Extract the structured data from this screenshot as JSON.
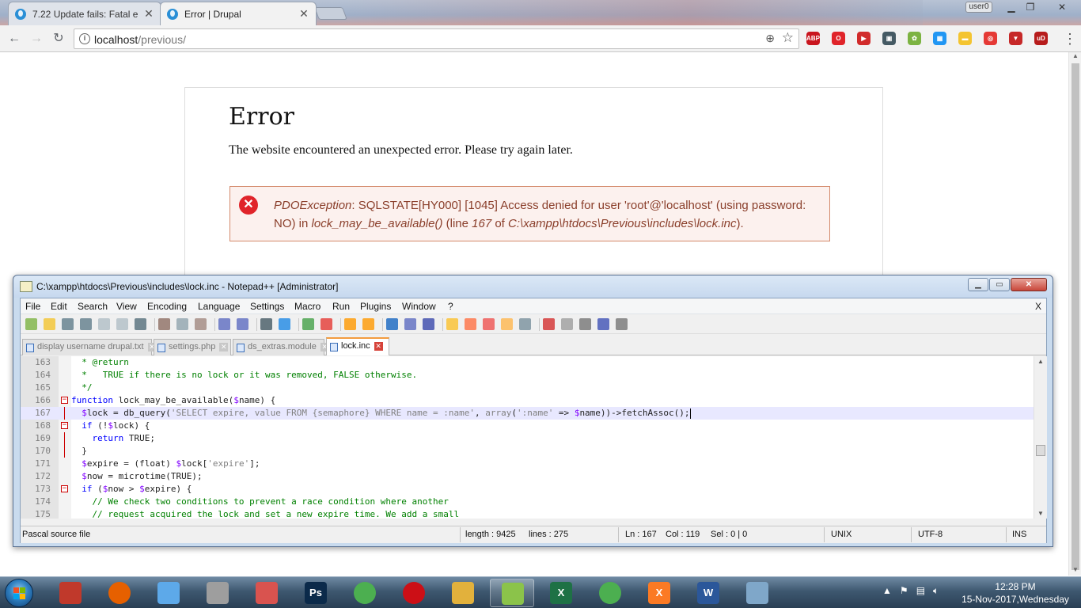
{
  "browser": {
    "tabs": [
      {
        "title": "7.22 Update fails: Fatal e",
        "active": false
      },
      {
        "title": "Error | Drupal",
        "active": true
      }
    ],
    "user_badge": "user0",
    "url_host": "localhost",
    "url_path": "/previous/",
    "extensions": [
      {
        "icon": "adblock-plus-icon",
        "label": "ABP",
        "color": "#c9151e"
      },
      {
        "icon": "opera-icon",
        "label": "O",
        "color": "#e0242a"
      },
      {
        "icon": "media-icon",
        "label": "▶",
        "color": "#d12b2b"
      },
      {
        "icon": "bus-icon",
        "label": "▣",
        "color": "#455a64"
      },
      {
        "icon": "basket-icon",
        "label": "✿",
        "color": "#7cb342"
      },
      {
        "icon": "calendar-icon",
        "label": "▦",
        "color": "#2196f3"
      },
      {
        "icon": "folder-icon",
        "label": "▬",
        "color": "#f4c430"
      },
      {
        "icon": "target-icon",
        "label": "◎",
        "color": "#e53935"
      },
      {
        "icon": "shield-icon",
        "label": "▼",
        "color": "#c62828"
      },
      {
        "icon": "ublock-icon",
        "label": "uD",
        "color": "#b71c1c"
      }
    ]
  },
  "page": {
    "title": "Error",
    "message": "The website encountered an unexpected error. Please try again later.",
    "exception": {
      "type": "PDOException",
      "text1": ": SQLSTATE[HY000] [1045] Access denied for user 'root'@'localhost' (using password: NO) in ",
      "function": "lock_may_be_available()",
      "text2": " (line ",
      "line": "167",
      "text3": " of ",
      "file": "C:\\xampp\\htdocs\\Previous\\includes\\lock.inc",
      "text4": ")."
    }
  },
  "npp": {
    "title": "C:\\xampp\\htdocs\\Previous\\includes\\lock.inc - Notepad++ [Administrator]",
    "menu": [
      "File",
      "Edit",
      "Search",
      "View",
      "Encoding",
      "Language",
      "Settings",
      "Macro",
      "Run",
      "Plugins",
      "Window",
      "?"
    ],
    "menu_close": "X",
    "tabs": [
      {
        "label": "display username drupal.txt",
        "active": false
      },
      {
        "label": "settings.php",
        "active": false
      },
      {
        "label": "ds_extras.module",
        "active": false
      },
      {
        "label": "lock.inc",
        "active": true
      }
    ],
    "lines": [
      {
        "n": "163",
        "code": "  * @return"
      },
      {
        "n": "164",
        "code": "  *   TRUE if there is no lock or it was removed, FALSE otherwise."
      },
      {
        "n": "165",
        "code": "  */"
      },
      {
        "n": "166",
        "code": "function lock_may_be_available($name) {"
      },
      {
        "n": "167",
        "code": "  $lock = db_query('SELECT expire, value FROM {semaphore} WHERE name = :name', array(':name' => $name))->fetchAssoc();"
      },
      {
        "n": "168",
        "code": "  if (!$lock) {"
      },
      {
        "n": "169",
        "code": "    return TRUE;"
      },
      {
        "n": "170",
        "code": "  }"
      },
      {
        "n": "171",
        "code": "  $expire = (float) $lock['expire'];"
      },
      {
        "n": "172",
        "code": "  $now = microtime(TRUE);"
      },
      {
        "n": "173",
        "code": "  if ($now > $expire) {"
      },
      {
        "n": "174",
        "code": "    // We check two conditions to prevent a race condition where another"
      },
      {
        "n": "175",
        "code": "    // request acquired the lock and set a new expire time. We add a small"
      }
    ],
    "status": {
      "type": "Pascal source file",
      "length": "length : 9425",
      "lines": "lines : 275",
      "ln": "Ln : 167",
      "col": "Col : 119",
      "sel": "Sel : 0 | 0",
      "eol": "UNIX",
      "encoding": "UTF-8",
      "mode": "INS"
    }
  },
  "taskbar": {
    "apps": [
      {
        "name": "filezilla-app",
        "label": "",
        "color": "#c0392b"
      },
      {
        "name": "firefox-app",
        "label": "",
        "color": "#e66000"
      },
      {
        "name": "paint-app",
        "label": "",
        "color": "#5da9e9"
      },
      {
        "name": "utility-app",
        "label": "",
        "color": "#9e9e9e"
      },
      {
        "name": "snipping-app",
        "label": "",
        "color": "#d9534f"
      },
      {
        "name": "photoshop-app",
        "label": "Ps",
        "color": "#0b2a4a"
      },
      {
        "name": "chrome-app",
        "label": "",
        "color": "#4caf50"
      },
      {
        "name": "opera-app",
        "label": "",
        "color": "#cc0f16"
      },
      {
        "name": "explorer-app",
        "label": "",
        "color": "#e2b13c"
      },
      {
        "name": "notepadpp-app",
        "label": "",
        "color": "#8bc34a"
      },
      {
        "name": "excel-app",
        "label": "X",
        "color": "#1e7145"
      },
      {
        "name": "chrome-app-2",
        "label": "",
        "color": "#4caf50"
      },
      {
        "name": "xampp-app",
        "label": "X",
        "color": "#fb7a24"
      },
      {
        "name": "word-app",
        "label": "W",
        "color": "#2b579a"
      },
      {
        "name": "notes-app",
        "label": "",
        "color": "#7fa7c9"
      }
    ],
    "time": "12:28 PM",
    "date": "15-Nov-2017,Wednesday"
  }
}
